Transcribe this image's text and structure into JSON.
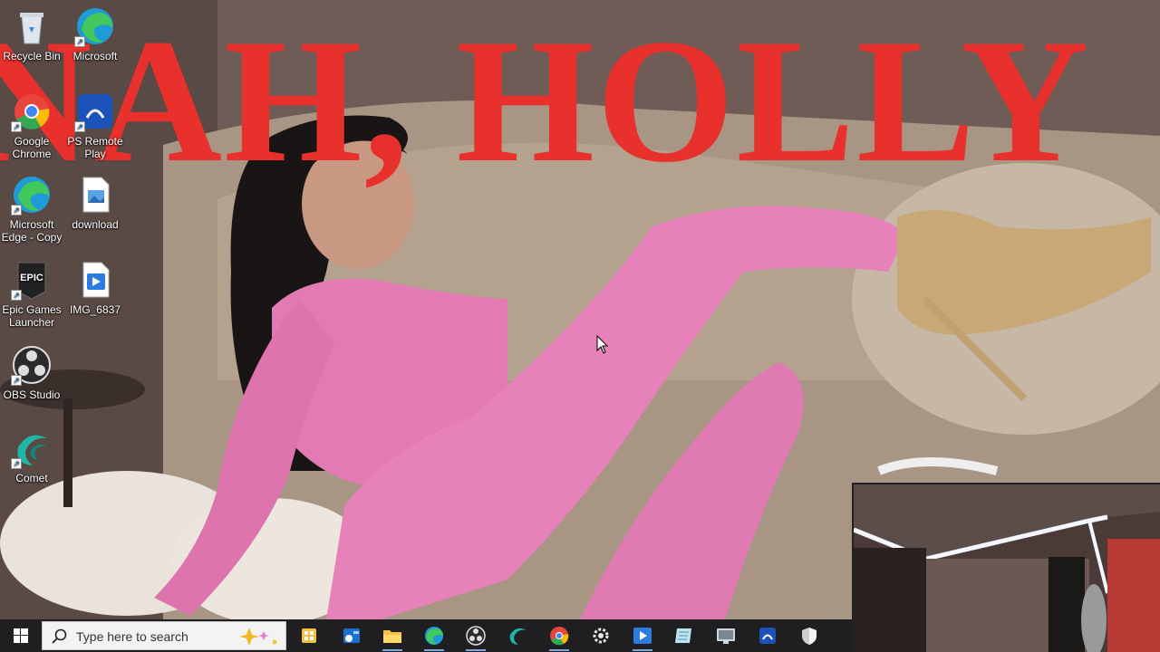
{
  "overlay": {
    "title": "NAH, HOLLY"
  },
  "desktop_icons": [
    {
      "label": "Recycle Bin",
      "icon": "recycle-bin-icon"
    },
    {
      "label": "Microsoft",
      "icon": "edge-icon"
    },
    {
      "label": "Google Chrome",
      "icon": "chrome-icon"
    },
    {
      "label": "PS Remote Play",
      "icon": "ps-remote-play-icon"
    },
    {
      "label": "Microsoft Edge - Copy",
      "icon": "edge-icon"
    },
    {
      "label": "download",
      "icon": "image-file-icon"
    },
    {
      "label": "Epic Games Launcher",
      "icon": "epic-games-icon"
    },
    {
      "label": "IMG_6837",
      "icon": "video-file-icon"
    },
    {
      "label": "OBS Studio",
      "icon": "obs-icon"
    },
    {
      "label": "Comet",
      "icon": "comet-icon"
    }
  ],
  "taskbar": {
    "search_placeholder": "Type here to search",
    "apps": [
      "task-view-icon",
      "outlook-icon",
      "file-explorer-icon",
      "edge-icon",
      "obs-icon",
      "comet-icon",
      "chrome-icon",
      "settings-icon",
      "video-player-icon",
      "notepad-icon",
      "remote-desktop-icon",
      "ps-remote-play-icon",
      "security-icon"
    ]
  },
  "colors": {
    "overlay_text": "#e8302c",
    "taskbar": "#1f1f22",
    "outfit_pink": "#e27bb4"
  }
}
